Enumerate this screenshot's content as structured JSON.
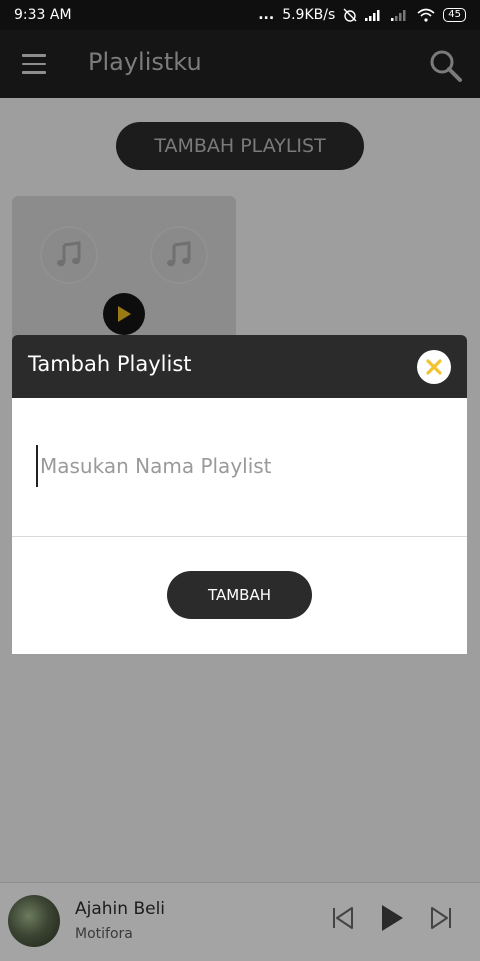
{
  "status_bar": {
    "time": "9:33 AM",
    "dots": "...",
    "speed": "5.9KB/s",
    "battery": "45"
  },
  "app_bar": {
    "title": "Playlistku"
  },
  "content": {
    "add_playlist_label": "TAMBAH PLAYLIST"
  },
  "dialog": {
    "title": "Tambah Playlist",
    "input_placeholder": "Masukan Nama Playlist",
    "input_value": "",
    "submit_label": "TAMBAH"
  },
  "mini_player": {
    "title": "Ajahin Beli",
    "artist": "Motifora"
  },
  "colors": {
    "accent": "#f2c230",
    "dark": "#2b2b2b"
  },
  "icons": [
    "menu-icon",
    "search-icon",
    "music-note-icon",
    "play-icon",
    "close-icon",
    "previous-icon",
    "next-icon"
  ]
}
